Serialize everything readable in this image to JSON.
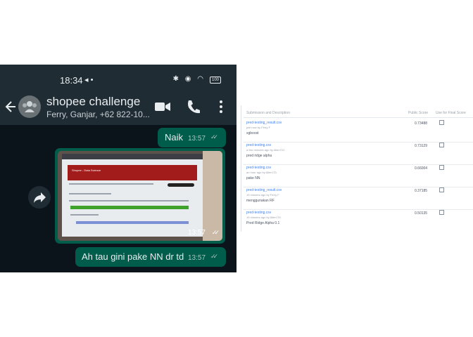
{
  "status_bar": {
    "time": "18:34",
    "icons": "◂ •",
    "system_icons": "✱ ◉ ◠",
    "battery": "100"
  },
  "chat": {
    "title": "shopee challenge",
    "subtitle": "Ferry, Ganjar, +62 822-10...",
    "messages": [
      {
        "text": "Naik",
        "time": "13:57"
      },
      {
        "type": "photo",
        "time": "13:57",
        "screen_banner": "Shopee - Data Science"
      },
      {
        "text": "Ah tau gini pake NN dr td",
        "time": "13:57"
      }
    ],
    "accent_color": "#005c4b",
    "header_color": "#1f2c34"
  },
  "leaderboard": {
    "headers": {
      "submission": "Submission and Description",
      "public_score": "Public Score",
      "use_for_final": "Use for Final Score"
    },
    "rows": [
      {
        "file": "pred-testing_result.csv",
        "meta": "just now by Ferry F",
        "desc": "xgboost",
        "score": "0.73488"
      },
      {
        "file": "pred-testing.csv",
        "meta": "a few minutes ago by Alien721",
        "desc": "pred ridge alpha",
        "score": "0.73129"
      },
      {
        "file": "pred-testing.csv",
        "meta": "an hour ago by Alien721",
        "desc": "pake NN",
        "score": "0.66004"
      },
      {
        "file": "pred-testing_result.csv",
        "meta": "15 minutes ago by Ferry F",
        "desc": "menggunakan RF",
        "score": "0.37185"
      },
      {
        "file": "pred-testing.csv",
        "meta": "15 minutes ago by Alien721",
        "desc": "Pred Ridge Alpha 0.1",
        "score": "0.50135"
      }
    ]
  }
}
